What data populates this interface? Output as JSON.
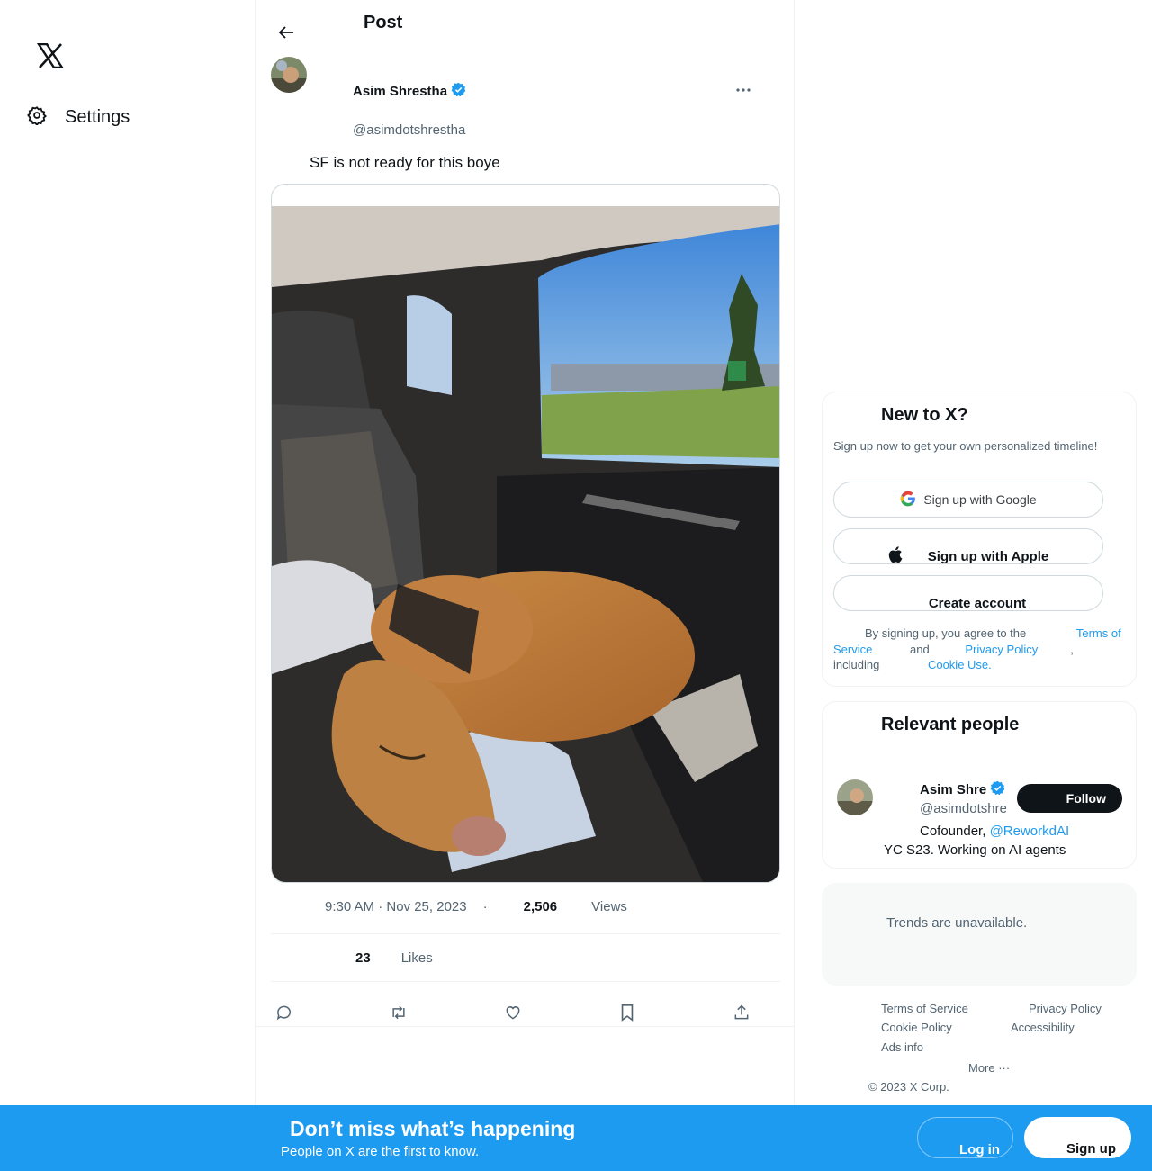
{
  "nav": {
    "logo_icon": "x-logo-icon",
    "settings_label": "Settings"
  },
  "header": {
    "title": "Post"
  },
  "tweet": {
    "author_name": "Asim Shrestha",
    "author_handle": "@asimdotshrestha",
    "verified": true,
    "text": "SF is not ready for this boye",
    "time": "9:30 AM · Nov 25, 2023",
    "separator": "·",
    "views_count": "2,506",
    "views_label": "Views",
    "likes_count": "23",
    "likes_label": "Likes",
    "actions": [
      "reply-icon",
      "repost-icon",
      "like-icon",
      "bookmark-icon",
      "share-icon"
    ]
  },
  "signup_card": {
    "title": "New to X?",
    "subtitle": "Sign up now to get your own personalized timeline!",
    "google_label": "Sign up with Google",
    "apple_label": "Sign up with Apple",
    "create_label": "Create account",
    "legal_prefix": "By signing up, you agree to the",
    "terms_link": "Terms of Service",
    "and_text": "and",
    "privacy_link": "Privacy Policy",
    "including_text": ", including",
    "cookie_link": "Cookie Use."
  },
  "relevant_people": {
    "title": "Relevant people",
    "name": "Asim Shre",
    "handle": "@asimdotshre",
    "follow_label": "Follow",
    "bio_lead": "Cofounder,",
    "bio_link": "@ReworkdAI",
    "bio_rest": "YC S23. Working on AI agents"
  },
  "trends": {
    "message": "Trends are unavailable."
  },
  "footer": {
    "terms": "Terms of Service",
    "privacy": "Privacy Policy",
    "cookie": "Cookie Policy",
    "accessibility": "Accessibility",
    "ads": "Ads info",
    "more": "More ···",
    "copyright": "© 2023 X Corp."
  },
  "bottom_bar": {
    "title": "Don’t miss what’s happening",
    "subtitle": "People on X are the first to know.",
    "login_label": "Log in",
    "signup_label": "Sign up"
  },
  "colors": {
    "accent": "#1d9bf0",
    "text": "#0f1419",
    "muted": "#536471"
  }
}
